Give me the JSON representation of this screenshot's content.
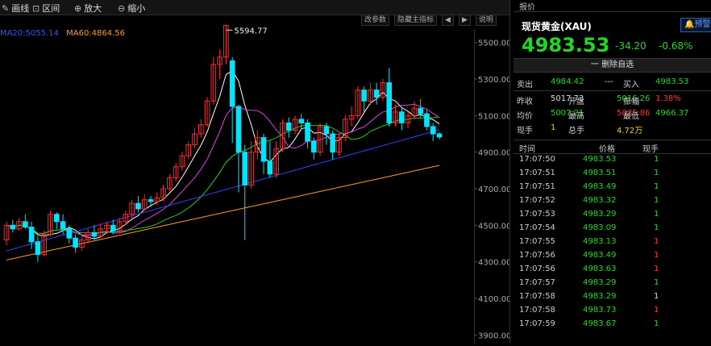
{
  "toolbar": {
    "items": [
      {
        "label": "画线",
        "icon": "draw-icon"
      },
      {
        "label": "区间",
        "icon": "range-icon"
      },
      {
        "label": "放大",
        "icon": "zoom-in-icon"
      },
      {
        "label": "缩小",
        "icon": "zoom-out-icon"
      }
    ],
    "sub_buttons": [
      "改参数",
      "隐藏主指标",
      "◀",
      "▶",
      "说明"
    ]
  },
  "legend": {
    "ma20": "MA20:5055.14",
    "ma60": "MA60:4864.56"
  },
  "colors": {
    "up": "#ff2a2a",
    "down": "#00e5ff",
    "ma5": "#ffffff",
    "ma10": "#e040e0",
    "ma20": "#22cc22",
    "ma30": "#3344ff",
    "ma60": "#ff9922",
    "green": "#21d821",
    "red": "#ff3333",
    "yellow": "#f4d000"
  },
  "chart_data": {
    "type": "candlestick",
    "y_ticks": [
      "5500.00",
      "5300.00",
      "5100.00",
      "4900.00",
      "4700.00",
      "4500.00",
      "4300.00",
      "4100.00",
      "3900.00"
    ],
    "ylim": [
      3800,
      5600
    ],
    "max_label": "5594.77",
    "candles": [
      [
        4420,
        4500,
        4390,
        4520
      ],
      [
        4500,
        4480,
        4460,
        4530
      ],
      [
        4480,
        4520,
        4470,
        4540
      ],
      [
        4520,
        4490,
        4480,
        4560
      ],
      [
        4490,
        4410,
        4370,
        4520
      ],
      [
        4410,
        4340,
        4300,
        4440
      ],
      [
        4340,
        4450,
        4330,
        4470
      ],
      [
        4450,
        4560,
        4440,
        4580
      ],
      [
        4560,
        4520,
        4480,
        4570
      ],
      [
        4520,
        4480,
        4450,
        4560
      ],
      [
        4480,
        4430,
        4400,
        4500
      ],
      [
        4430,
        4380,
        4350,
        4450
      ],
      [
        4380,
        4420,
        4360,
        4440
      ],
      [
        4420,
        4460,
        4400,
        4480
      ],
      [
        4460,
        4440,
        4420,
        4500
      ],
      [
        4440,
        4480,
        4430,
        4510
      ],
      [
        4480,
        4500,
        4460,
        4520
      ],
      [
        4500,
        4470,
        4450,
        4530
      ],
      [
        4470,
        4520,
        4460,
        4540
      ],
      [
        4520,
        4560,
        4500,
        4580
      ],
      [
        4560,
        4620,
        4540,
        4640
      ],
      [
        4620,
        4590,
        4570,
        4660
      ],
      [
        4590,
        4640,
        4580,
        4670
      ],
      [
        4640,
        4630,
        4600,
        4660
      ],
      [
        4630,
        4650,
        4610,
        4680
      ],
      [
        4650,
        4700,
        4630,
        4720
      ],
      [
        4700,
        4760,
        4690,
        4780
      ],
      [
        4760,
        4820,
        4740,
        4840
      ],
      [
        4820,
        4880,
        4800,
        4900
      ],
      [
        4880,
        4940,
        4860,
        4960
      ],
      [
        4940,
        5000,
        4920,
        5030
      ],
      [
        5000,
        5050,
        4980,
        5080
      ],
      [
        5050,
        5180,
        5040,
        5200
      ],
      [
        5180,
        5380,
        5160,
        5420
      ],
      [
        5380,
        5420,
        5300,
        5460
      ],
      [
        5420,
        5594,
        5380,
        5594
      ],
      [
        5400,
        5150,
        4950,
        5420
      ],
      [
        5150,
        4900,
        4680,
        5160
      ],
      [
        4900,
        4720,
        4420,
        4940
      ],
      [
        4720,
        4900,
        4700,
        4960
      ],
      [
        4900,
        4980,
        4860,
        5020
      ],
      [
        4980,
        4850,
        4780,
        5000
      ],
      [
        4850,
        4780,
        4760,
        4960
      ],
      [
        4780,
        4920,
        4760,
        4960
      ],
      [
        4920,
        5060,
        4900,
        5080
      ],
      [
        5060,
        5020,
        4980,
        5090
      ],
      [
        5020,
        5080,
        5000,
        5100
      ],
      [
        5080,
        5060,
        5020,
        5110
      ],
      [
        5060,
        4960,
        4920,
        5080
      ],
      [
        4960,
        4900,
        4860,
        4980
      ],
      [
        4900,
        5040,
        4880,
        5060
      ],
      [
        5040,
        5000,
        4940,
        5060
      ],
      [
        5000,
        4900,
        4860,
        5020
      ],
      [
        4900,
        4980,
        4880,
        5000
      ],
      [
        4980,
        5080,
        4960,
        5100
      ],
      [
        5080,
        5100,
        5040,
        5150
      ],
      [
        5100,
        5240,
        5080,
        5260
      ],
      [
        5240,
        5180,
        5120,
        5260
      ],
      [
        5180,
        5240,
        5160,
        5280
      ],
      [
        5240,
        5200,
        5160,
        5280
      ],
      [
        5200,
        5280,
        5180,
        5300
      ],
      [
        5280,
        5060,
        5040,
        5360
      ],
      [
        5060,
        5120,
        5040,
        5160
      ],
      [
        5120,
        5060,
        5020,
        5140
      ],
      [
        5060,
        5100,
        5030,
        5120
      ],
      [
        5100,
        5140,
        5080,
        5180
      ],
      [
        5140,
        5110,
        5090,
        5190
      ],
      [
        5110,
        5040,
        5020,
        5130
      ],
      [
        5040,
        5000,
        4960,
        5060
      ],
      [
        5000,
        4983,
        4970,
        5010
      ]
    ]
  },
  "panel": {
    "tab": "报价",
    "title": "现货黄金(XAU)",
    "pre_button": "预警",
    "price": "4983.53",
    "arrow": "↓",
    "change": "-34.20",
    "change_pct": "-0.68%",
    "delete_label": "一 删除自选",
    "sell_label": "卖出",
    "sell_price": "4984.42",
    "sell_vol": "---",
    "buy_label": "买入",
    "buy_price": "4983.53",
    "stats": [
      [
        {
          "l": "昨收",
          "v": "5017.73",
          "c": "w"
        },
        {
          "l": "开盘",
          "v": "5016.26",
          "c": "g"
        },
        {
          "l": "振幅",
          "v": "1.38%",
          "c": "r"
        }
      ],
      [
        {
          "l": "均价",
          "v": "5007.21",
          "c": "g"
        },
        {
          "l": "最高",
          "v": "5035.86",
          "c": "r"
        },
        {
          "l": "最低",
          "v": "4966.37",
          "c": "g"
        }
      ],
      [
        {
          "l": "现手",
          "v": "1",
          "c": "y"
        },
        {
          "l": "总手",
          "v": "4.72万",
          "c": "y"
        },
        {
          "l": "",
          "v": "",
          "c": "w"
        }
      ]
    ],
    "tick_headers": [
      "时间",
      "价格",
      "现手"
    ],
    "ticks": [
      {
        "t": "17:07:50",
        "p": "4983.53",
        "v": "1",
        "vc": "g"
      },
      {
        "t": "17:07:51",
        "p": "4983.51",
        "v": "1",
        "vc": "g"
      },
      {
        "t": "17:07:51",
        "p": "4983.49",
        "v": "1",
        "vc": "g"
      },
      {
        "t": "17:07:52",
        "p": "4983.32",
        "v": "1",
        "vc": "g"
      },
      {
        "t": "17:07:53",
        "p": "4983.29",
        "v": "1",
        "vc": "g"
      },
      {
        "t": "17:07:54",
        "p": "4983.09",
        "v": "1",
        "vc": "g"
      },
      {
        "t": "17:07:55",
        "p": "4983.13",
        "v": "1",
        "vc": "r"
      },
      {
        "t": "17:07:56",
        "p": "4983.49",
        "v": "1",
        "vc": "r"
      },
      {
        "t": "17:07:56",
        "p": "4983.63",
        "v": "1",
        "vc": "r"
      },
      {
        "t": "17:07:57",
        "p": "4983.29",
        "v": "1",
        "vc": "g"
      },
      {
        "t": "17:07:58",
        "p": "4983.29",
        "v": "1",
        "vc": "w"
      },
      {
        "t": "17:07:58",
        "p": "4983.73",
        "v": "1",
        "vc": "r"
      },
      {
        "t": "17:07:59",
        "p": "4983.67",
        "v": "1",
        "vc": "g"
      }
    ]
  }
}
